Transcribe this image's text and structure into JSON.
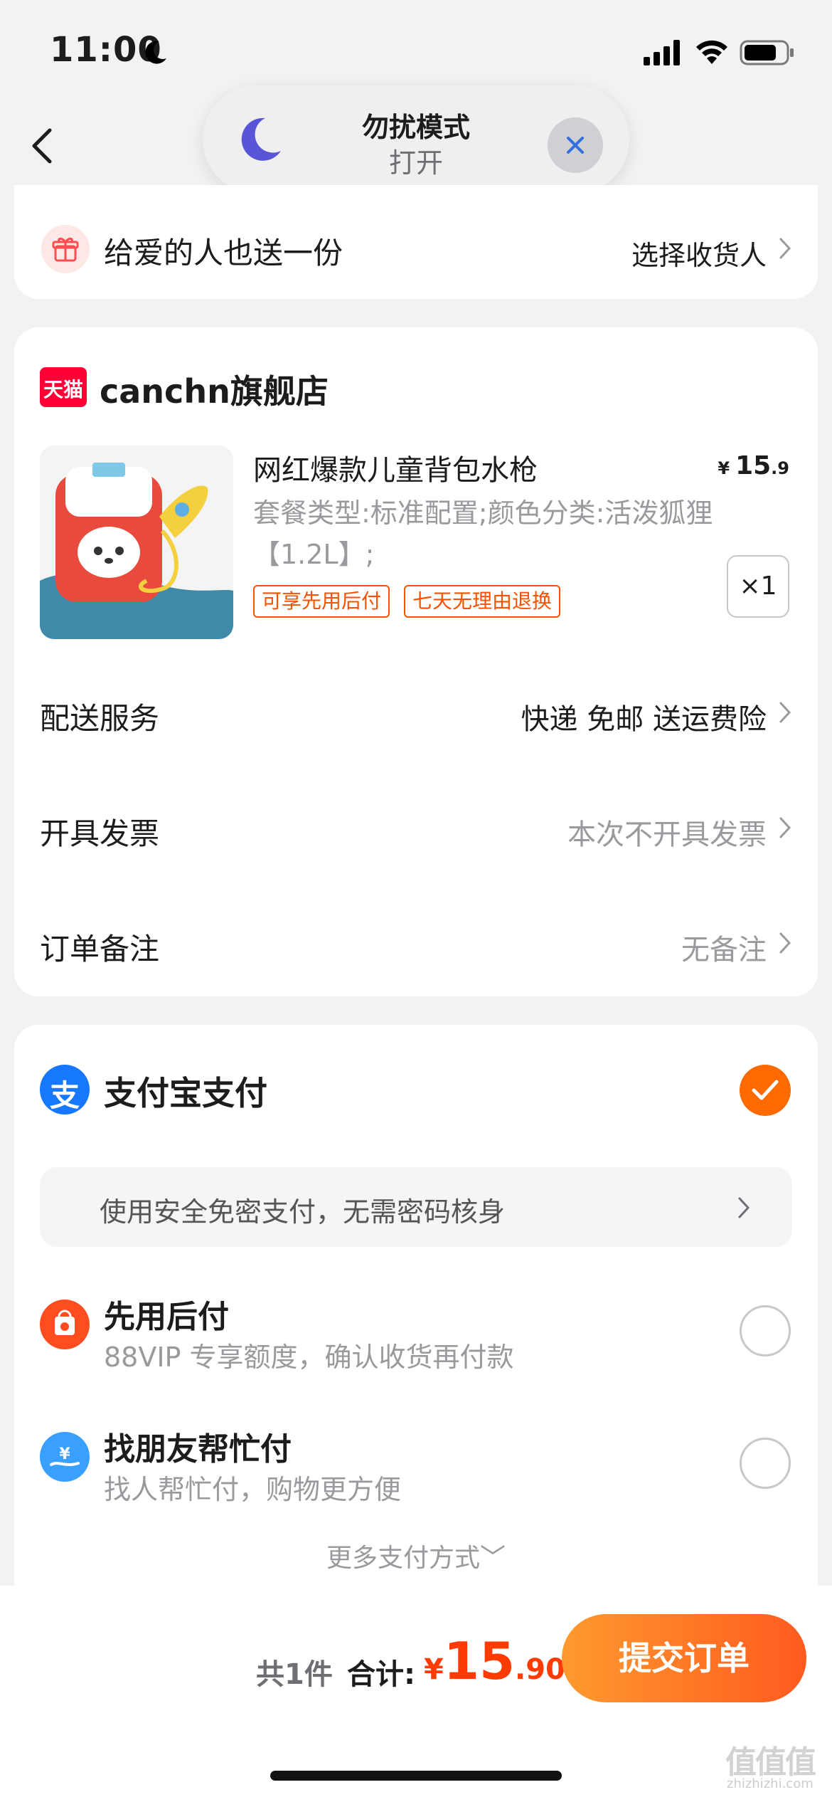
{
  "status": {
    "time": "11:00"
  },
  "dnd": {
    "title": "勿扰模式",
    "subtitle": "打开"
  },
  "gift": {
    "label": "给爱的人也送一份",
    "action": "选择收货人"
  },
  "shop": {
    "logo_text": "天猫",
    "name": "canchn旗舰店"
  },
  "product": {
    "title": "网红爆款儿童背包水枪",
    "spec": "套餐类型:标准配置;颜色分类:活泼狐狸【1.2L】;",
    "tags": [
      "可享先用后付",
      "七天无理由退换"
    ],
    "price_currency": "¥",
    "price_int": "15",
    "price_dec": ".9",
    "quantity": "×1"
  },
  "rows": [
    {
      "label": "配送服务",
      "value": "快递 免邮 送运费险"
    },
    {
      "label": "开具发票",
      "value": "本次不开具发票"
    },
    {
      "label": "订单备注",
      "value": "无备注"
    }
  ],
  "payment": {
    "alipay_label": "支付宝支付",
    "alipay_icon_text": "支",
    "secure_text": "使用安全免密支付，无需密码核身",
    "options": [
      {
        "title": "先用后付",
        "subtitle": "88VIP 专享额度，确认收货再付款"
      },
      {
        "title": "找朋友帮忙付",
        "subtitle": "找人帮忙付，购物更方便"
      }
    ],
    "more": "更多支付方式﹀"
  },
  "footer": {
    "count": "共1件",
    "total_label": "合计:",
    "currency": "¥",
    "total_int": "15",
    "total_dec": ".90",
    "submit": "提交订单"
  },
  "watermark": {
    "main": "值值值",
    "sub": "zhizhizhi.com"
  },
  "colors": {
    "accent": "#ff5000",
    "alipay": "#1677ff",
    "price": "#ff3b00"
  },
  "icons": [
    "moon-icon",
    "signal-icon",
    "wifi-icon",
    "battery-icon",
    "back-icon",
    "close-icon",
    "gift-icon",
    "chevron-right-icon",
    "alipay-icon",
    "checkmark-icon",
    "pay-later-icon",
    "friend-pay-icon"
  ]
}
